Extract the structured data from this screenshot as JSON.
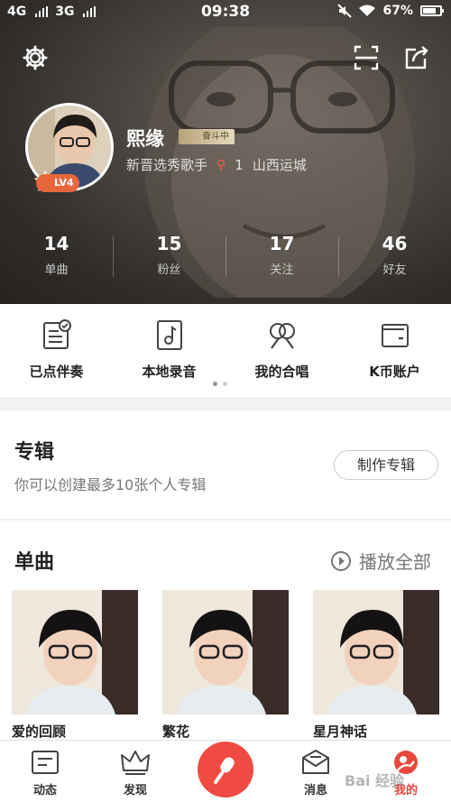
{
  "status_bar": {
    "network_1": "4G",
    "network_2": "3G",
    "time": "09:38",
    "battery": "67%"
  },
  "profile": {
    "username": "熙缘",
    "rank_badge": "奋斗中",
    "level": "LV4",
    "title": "新晋选秀歌手",
    "location_count": "1",
    "location": "山西运城"
  },
  "stats": [
    {
      "value": "14",
      "label": "单曲"
    },
    {
      "value": "15",
      "label": "粉丝"
    },
    {
      "value": "17",
      "label": "关注"
    },
    {
      "value": "46",
      "label": "好友"
    }
  ],
  "quick_actions": [
    {
      "label": "已点伴奏",
      "icon": "song-list-icon"
    },
    {
      "label": "本地录音",
      "icon": "local-recording-icon"
    },
    {
      "label": "我的合唱",
      "icon": "chorus-icon"
    },
    {
      "label": "K币账户",
      "icon": "wallet-icon"
    }
  ],
  "album": {
    "title": "专辑",
    "description": "你可以创建最多10张个人专辑",
    "make_button": "制作专辑"
  },
  "singles": {
    "title": "单曲",
    "play_all": "播放全部",
    "songs": [
      {
        "title": "爱的回顾"
      },
      {
        "title": "繁花"
      },
      {
        "title": "星月神话"
      }
    ]
  },
  "bottom_nav": [
    {
      "label": "动态",
      "icon": "feed-icon"
    },
    {
      "label": "发现",
      "icon": "crown-icon"
    },
    {
      "label": "消息",
      "icon": "message-icon"
    },
    {
      "label": "我的",
      "icon": "profile-icon"
    }
  ],
  "watermark": "Bai 经验",
  "colors": {
    "accent_red": "#ef4b42",
    "level_orange": "#e8663c",
    "rank_gold": "#b8a37a"
  }
}
